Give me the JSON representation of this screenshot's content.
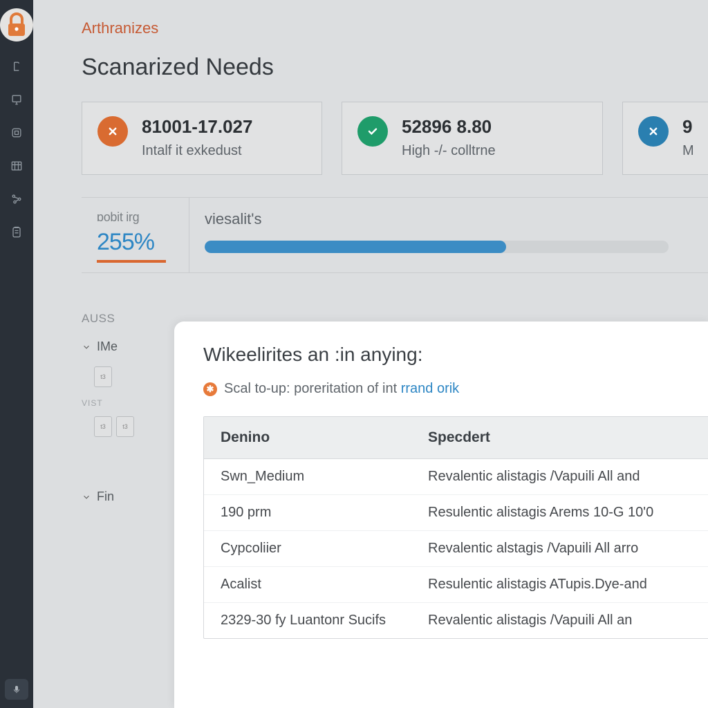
{
  "breadcrumb": "Arthranizes",
  "page_title": "Scanarized Needs",
  "cards": [
    {
      "value": "81001-17.027",
      "sub": "Intalf it exkedust",
      "badge": "x-orange"
    },
    {
      "value": "52896 8.80",
      "sub": "High -/- colltrne",
      "badge": "check-green"
    },
    {
      "value": "9",
      "sub": "M",
      "badge": "x-blue"
    }
  ],
  "stat": {
    "label": "ɒobit irg",
    "value": "255%"
  },
  "progress": {
    "label": "viesalit's",
    "percent": 65
  },
  "section_label": "AUSS",
  "left_acc": {
    "item1": "IMe",
    "mini1": "t3",
    "mini2": "t3",
    "small": "VIST",
    "mini3": "t3",
    "mini4": "t3",
    "item2": "Fin"
  },
  "panel": {
    "title": "Wikeelirites an :in anying:",
    "note_prefix": "Scal to-up: poreritation of int ",
    "note_link": "rrand orik",
    "columns": [
      "Denino",
      "Specdert"
    ],
    "rows": [
      [
        "Swn_Medium",
        "Revalentic alistagis /Vapuili All and "
      ],
      [
        "190 prm",
        "Resulentic alistagis Arems 10-G 10'0"
      ],
      [
        "Cypcoliier",
        "Revalentic alstagis /Vapuili All arro "
      ],
      [
        "Acalist",
        "Resulentic alistagis ATupis.Dye-and "
      ],
      [
        "2329-30 fy Luantonr Sucifs",
        "Revalentic alistagis /Vapuili All an"
      ]
    ]
  }
}
